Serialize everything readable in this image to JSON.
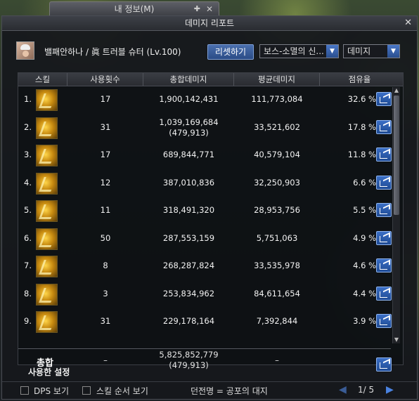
{
  "background_window": {
    "title": "내 정보(M)"
  },
  "window": {
    "title": "데미지 리포트"
  },
  "header": {
    "character_name": "밸패안하나 / 眞 트러블 슈터 (Lv.100)",
    "reset_label": "리셋하기",
    "target_dropdown": "보스-소멸의 신...",
    "metric_dropdown": "데미지"
  },
  "table": {
    "columns": [
      "스킬",
      "사용횟수",
      "총합데미지",
      "평균데미지",
      "점유율"
    ],
    "rows": [
      {
        "rank": "1.",
        "uses": "17",
        "total": "1,900,142,431",
        "total_sub": "",
        "avg": "111,773,084",
        "share": "32.6 %"
      },
      {
        "rank": "2.",
        "uses": "31",
        "total": "1,039,169,684",
        "total_sub": "(479,913)",
        "avg": "33,521,602",
        "share": "17.8 %"
      },
      {
        "rank": "3.",
        "uses": "17",
        "total": "689,844,771",
        "total_sub": "",
        "avg": "40,579,104",
        "share": "11.8 %"
      },
      {
        "rank": "4.",
        "uses": "12",
        "total": "387,010,836",
        "total_sub": "",
        "avg": "32,250,903",
        "share": "6.6 %"
      },
      {
        "rank": "5.",
        "uses": "11",
        "total": "318,491,320",
        "total_sub": "",
        "avg": "28,953,756",
        "share": "5.5 %"
      },
      {
        "rank": "6.",
        "uses": "50",
        "total": "287,553,159",
        "total_sub": "",
        "avg": "5,751,063",
        "share": "4.9 %"
      },
      {
        "rank": "7.",
        "uses": "8",
        "total": "268,287,824",
        "total_sub": "",
        "avg": "33,535,978",
        "share": "4.6 %"
      },
      {
        "rank": "8.",
        "uses": "3",
        "total": "253,834,962",
        "total_sub": "",
        "avg": "84,611,654",
        "share": "4.4 %"
      },
      {
        "rank": "9.",
        "uses": "31",
        "total": "229,178,164",
        "total_sub": "",
        "avg": "7,392,844",
        "share": "3.9 %"
      }
    ],
    "summary": {
      "label": "총합",
      "uses": "–",
      "total": "5,825,852,779",
      "total_sub": "(479,913)",
      "avg": "–"
    }
  },
  "footer": {
    "settings_label": "사용한 설정",
    "dps_label": "DPS 보기",
    "skill_order_label": "스킬 순서 보기",
    "dungeon_text": "던전명 = 공포의 대지",
    "page_text": "1/ 5"
  },
  "colors": {
    "accent_blue": "#2b4c86",
    "skill_icon_gold": "#c78a10"
  },
  "icons": [
    "close-icon",
    "pin-icon",
    "share-icon",
    "chevron-down-icon",
    "chevron-left-icon",
    "chevron-right-icon"
  ]
}
